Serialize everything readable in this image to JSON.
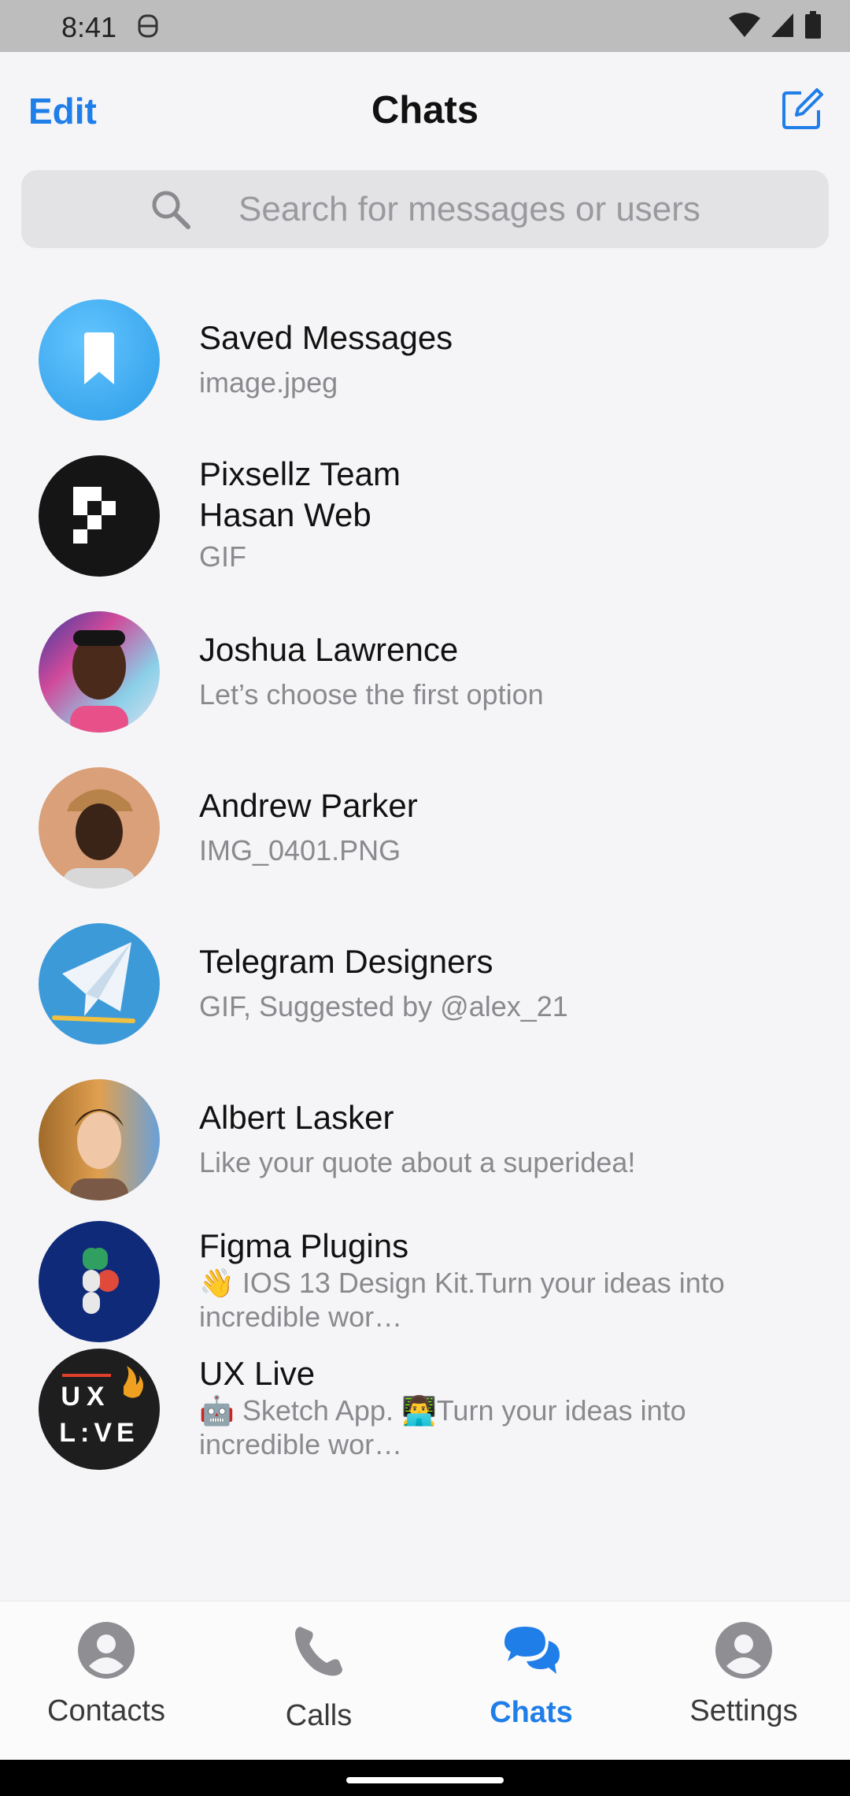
{
  "status_bar": {
    "time": "8:41"
  },
  "header": {
    "edit_label": "Edit",
    "title": "Chats"
  },
  "search": {
    "placeholder": "Search for messages or users"
  },
  "chats": [
    {
      "name": "Saved Messages",
      "preview": "image.jpeg",
      "avatar": "saved-messages-bookmark"
    },
    {
      "name": "Pixsellz Team",
      "sender": "Hasan Web",
      "preview": "GIF",
      "avatar": "pixsellz-logo"
    },
    {
      "name": "Joshua Lawrence",
      "preview": "Let’s choose the first option",
      "avatar": "photo"
    },
    {
      "name": "Andrew Parker",
      "preview": "IMG_0401.PNG",
      "avatar": "photo"
    },
    {
      "name": "Telegram Designers",
      "preview": "GIF, Suggested by @alex_21",
      "avatar": "paper-plane"
    },
    {
      "name": "Albert Lasker",
      "preview": "Like your quote about a superidea!",
      "avatar": "photo"
    },
    {
      "name": "Figma Plugins",
      "preview_line1": "👋 IOS 13 Design Kit.Turn your ideas into",
      "preview_line2": "incredible wor…",
      "avatar": "figma-logo"
    },
    {
      "name": "UX Live",
      "preview_line1": "🤖 Sketch App. 👨‍💻Turn your ideas into",
      "preview_line2": "incredible wor…",
      "avatar": "ux-live-logo"
    }
  ],
  "bottom_nav": {
    "items": [
      {
        "label": "Contacts",
        "icon": "person-icon",
        "active": false
      },
      {
        "label": "Calls",
        "icon": "phone-icon",
        "active": false
      },
      {
        "label": "Chats",
        "icon": "chat-bubbles-icon",
        "active": true
      },
      {
        "label": "Settings",
        "icon": "person-icon",
        "active": false
      }
    ]
  },
  "colors": {
    "accent": "#1f7ee8",
    "background": "#f5f5f7",
    "status_bar": "#bdbdbd"
  }
}
